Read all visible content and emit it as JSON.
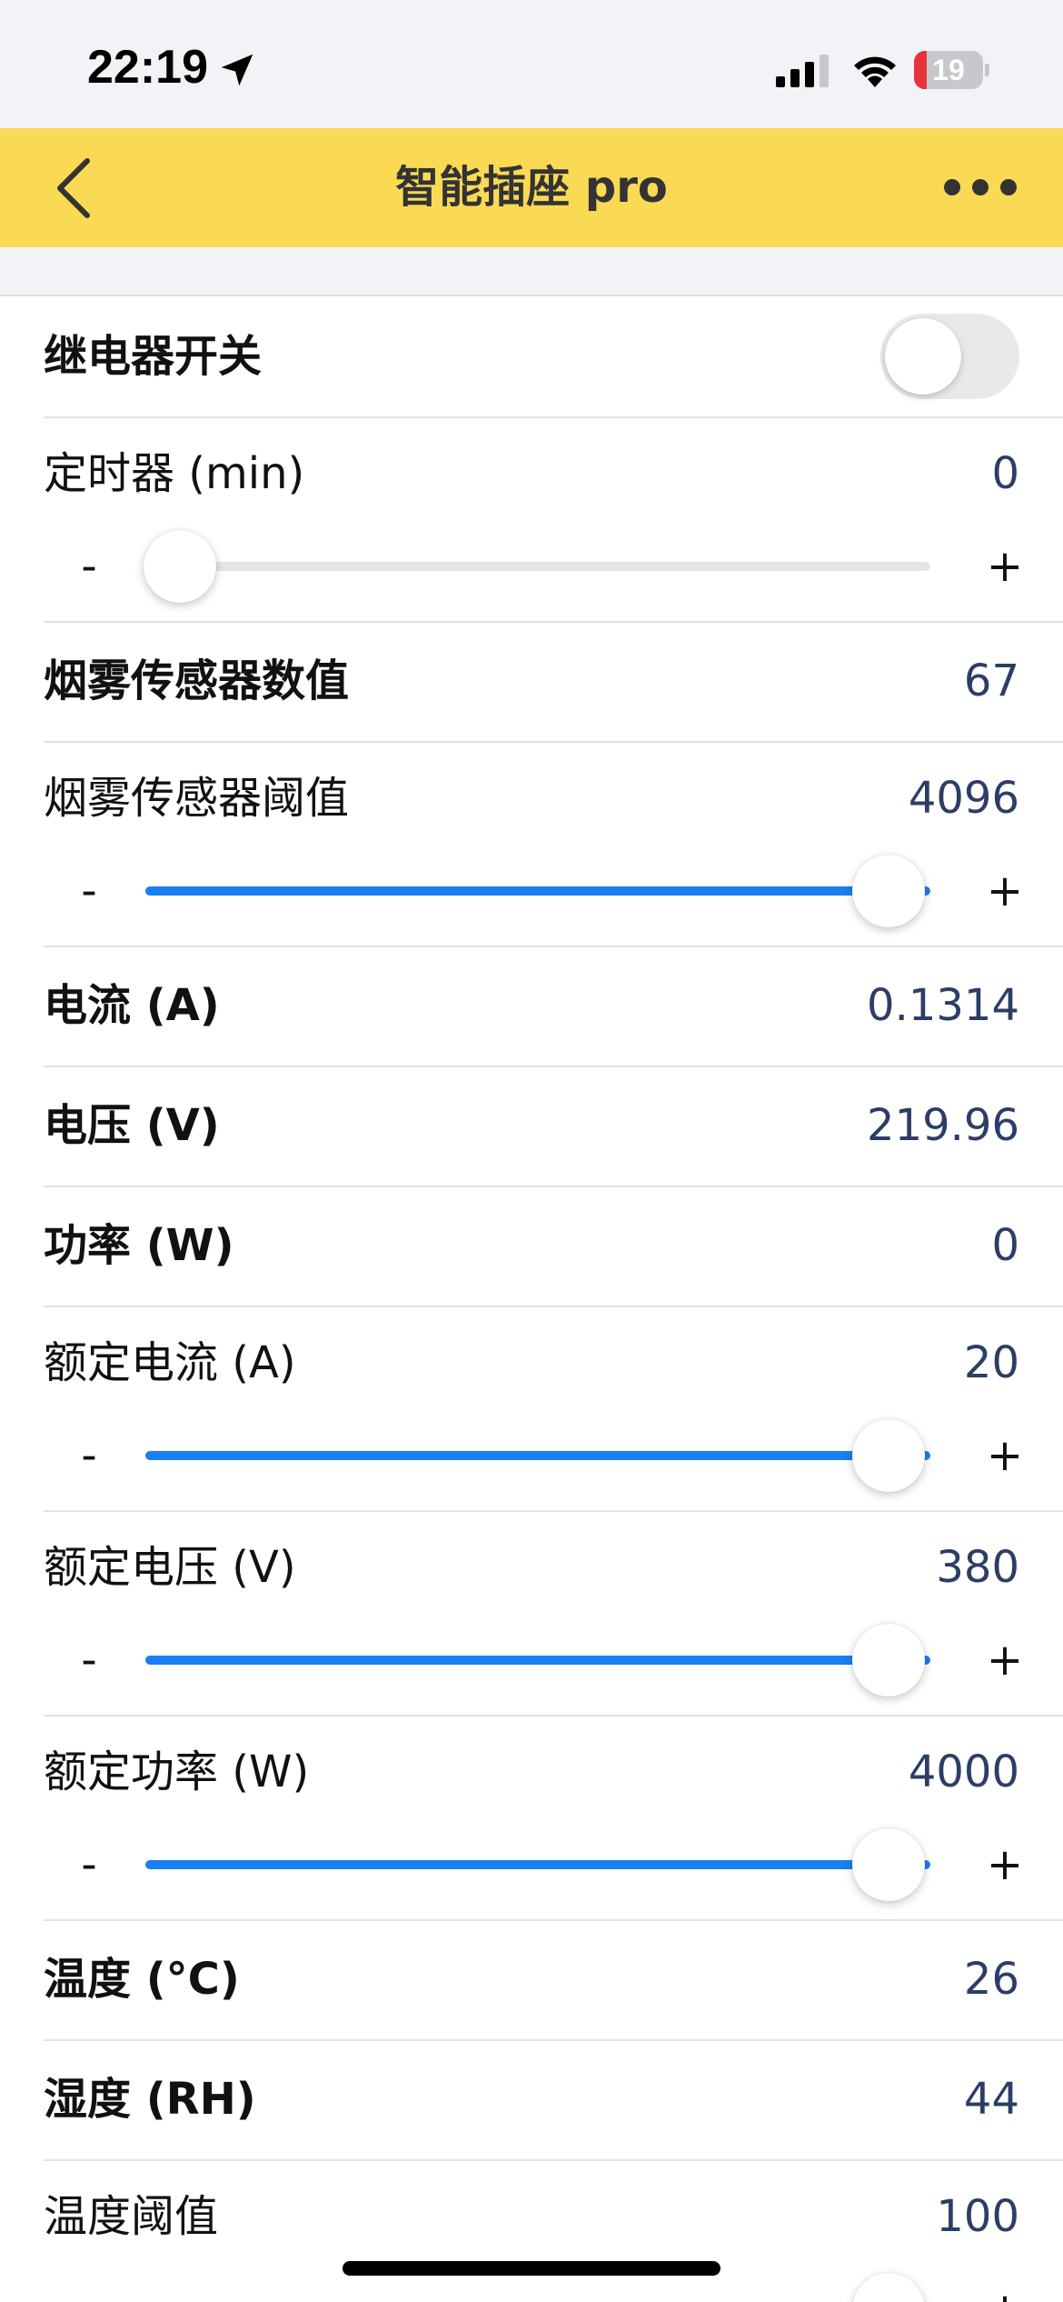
{
  "status_bar": {
    "time": "22:19",
    "battery_text": "19",
    "battery_level": 0.19,
    "battery_color": "#e9333a"
  },
  "nav": {
    "title": "智能插座 pro",
    "back_icon": "chevron-left-icon",
    "more_icon": "ellipsis-icon",
    "background": "#fad955"
  },
  "accent_color": "#1a7ff0",
  "rows": [
    {
      "id": "relay",
      "type": "switch",
      "label": "继电器开关",
      "on": false
    },
    {
      "id": "timer",
      "type": "slider",
      "label": "定时器 (min)",
      "value": "0",
      "minus": "-",
      "plus": "+",
      "fraction": 0.0
    },
    {
      "id": "smoke-value",
      "type": "value",
      "label": "烟雾传感器数值",
      "value": "67"
    },
    {
      "id": "smoke-threshold",
      "type": "slider",
      "label": "烟雾传感器阈值",
      "value": "4096",
      "minus": "-",
      "plus": "+",
      "fraction": 1.0
    },
    {
      "id": "current",
      "type": "value",
      "label": "电流 (A)",
      "value": "0.1314"
    },
    {
      "id": "voltage",
      "type": "value",
      "label": "电压 (V)",
      "value": "219.96"
    },
    {
      "id": "power",
      "type": "value",
      "label": "功率 (W)",
      "value": "0"
    },
    {
      "id": "rated-current",
      "type": "slider",
      "label": "额定电流 (A)",
      "value": "20",
      "minus": "-",
      "plus": "+",
      "fraction": 1.0
    },
    {
      "id": "rated-voltage",
      "type": "slider",
      "label": "额定电压 (V)",
      "value": "380",
      "minus": "-",
      "plus": "+",
      "fraction": 1.0
    },
    {
      "id": "rated-power",
      "type": "slider",
      "label": "额定功率 (W)",
      "value": "4000",
      "minus": "-",
      "plus": "+",
      "fraction": 1.0
    },
    {
      "id": "temperature",
      "type": "value",
      "label": "温度 (°C)",
      "value": "26"
    },
    {
      "id": "humidity",
      "type": "value",
      "label": "湿度 (RH)",
      "value": "44"
    },
    {
      "id": "temp-threshold",
      "type": "slider",
      "label": "温度阈值",
      "value": "100",
      "minus": "-",
      "plus": "+",
      "fraction": 1.0
    }
  ]
}
